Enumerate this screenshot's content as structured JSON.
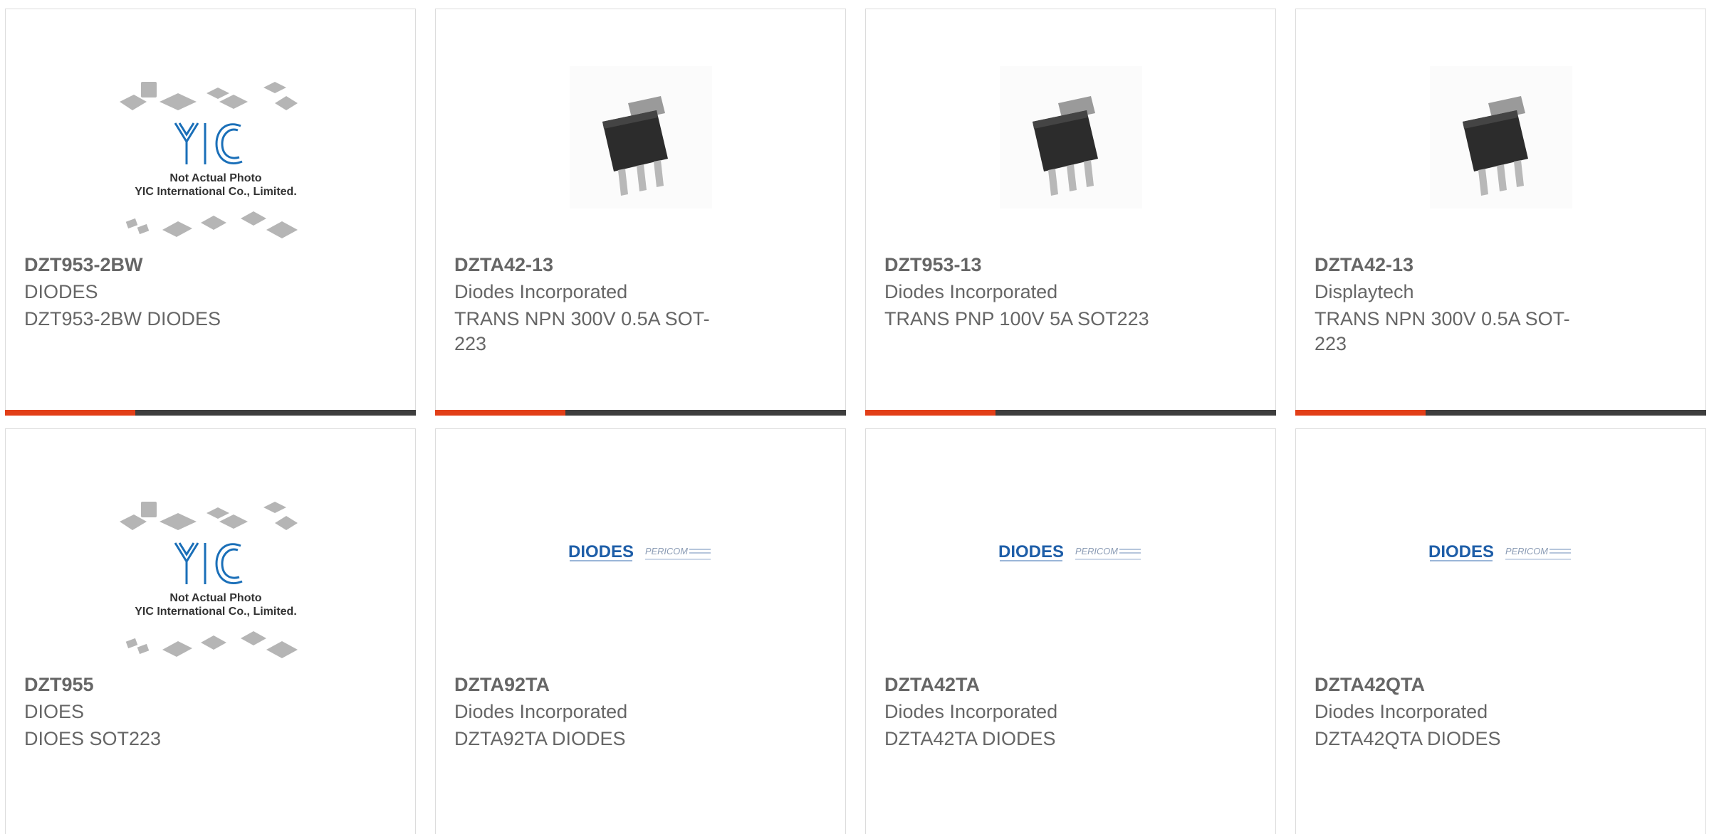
{
  "colors": {
    "accent": "#e23f18",
    "bar_dark": "#3e3e3e",
    "text": "#666666",
    "yic_blue": "#1a6fb8",
    "diodes_blue": "#1e5ea8"
  },
  "placeholder": {
    "logo": "YIC",
    "line1": "Not Actual Photo",
    "line2": "YIC International Co., Limited."
  },
  "diodes_logo": {
    "brand": "DIODES",
    "partner": "PERICOM"
  },
  "products": [
    {
      "part_number": "DZT953-2BW",
      "manufacturer": "DIODES",
      "description": "DZT953-2BW DIODES",
      "image": "yic-placeholder"
    },
    {
      "part_number": "DZTA42-13",
      "manufacturer": "Diodes Incorporated",
      "description": "TRANS NPN 300V 0.5A SOT-223",
      "image": "sot223-photo"
    },
    {
      "part_number": "DZT953-13",
      "manufacturer": "Diodes Incorporated",
      "description": "TRANS PNP 100V 5A SOT223",
      "image": "sot223-photo"
    },
    {
      "part_number": "DZTA42-13",
      "manufacturer": "Displaytech",
      "description": "TRANS NPN 300V 0.5A SOT-223",
      "image": "sot223-photo"
    },
    {
      "part_number": "DZT955",
      "manufacturer": "DIOES",
      "description": "DIOES SOT223",
      "image": "yic-placeholder"
    },
    {
      "part_number": "DZTA92TA",
      "manufacturer": "Diodes Incorporated",
      "description": "DZTA92TA DIODES",
      "image": "diodes-logo"
    },
    {
      "part_number": "DZTA42TA",
      "manufacturer": "Diodes Incorporated",
      "description": "DZTA42TA DIODES",
      "image": "diodes-logo"
    },
    {
      "part_number": "DZTA42QTA",
      "manufacturer": "Diodes Incorporated",
      "description": "DZTA42QTA DIODES",
      "image": "diodes-logo"
    }
  ]
}
